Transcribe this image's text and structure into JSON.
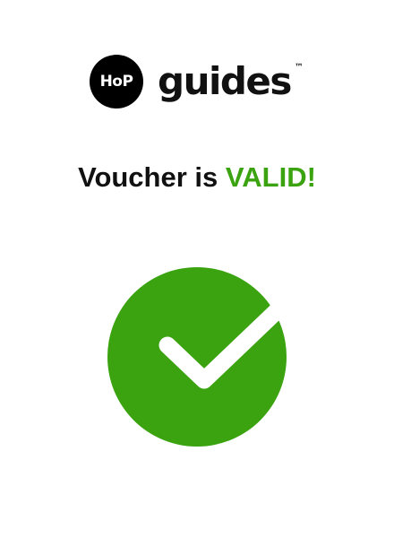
{
  "brand": {
    "logo_text": "HoP",
    "name": "guides",
    "trademark": "™"
  },
  "status": {
    "prefix": "Voucher is",
    "highlight": "VALID!",
    "highlight_color": "#3aa30f"
  },
  "indicator": {
    "icon": "checkmark-circle-icon",
    "color": "#3aa30f"
  }
}
